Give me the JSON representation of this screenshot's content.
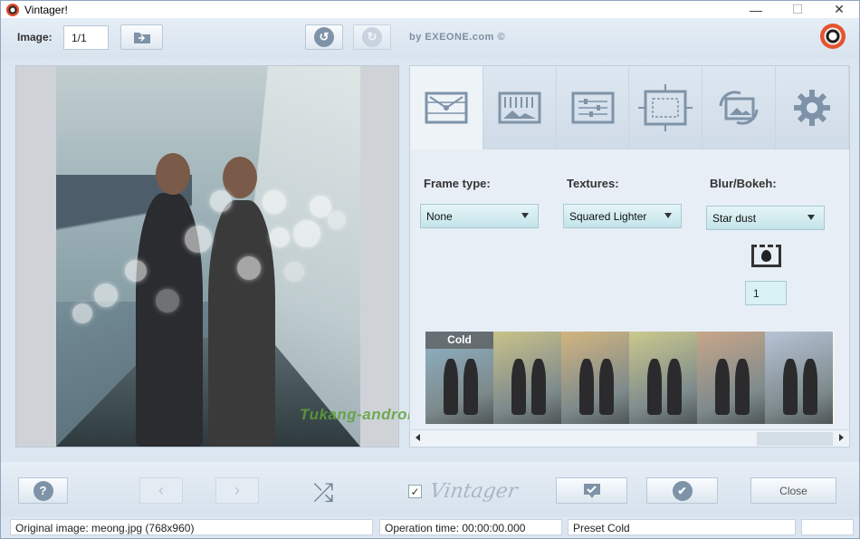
{
  "window": {
    "title": "Vintager!",
    "minimize": "—",
    "maximize": "☐",
    "close": "✕"
  },
  "toolbar": {
    "image_label": "Image:",
    "image_value": "1/1",
    "brand": "by EXEONE.com ©"
  },
  "tabs": [
    {
      "name": "frame",
      "icon": "frame-icon"
    },
    {
      "name": "textures",
      "icon": "texture-icon"
    },
    {
      "name": "adjustments",
      "icon": "sliders-icon"
    },
    {
      "name": "crop",
      "icon": "crop-icon"
    },
    {
      "name": "rotate",
      "icon": "rotate-icon"
    },
    {
      "name": "settings",
      "icon": "gear-icon"
    }
  ],
  "options": {
    "frame_label": "Frame type:",
    "frame_value": "None",
    "textures_label": "Textures:",
    "textures_value": "Squared Lighter",
    "blur_label": "Blur/Bokeh:",
    "blur_value": "Star dust",
    "blur_amount": "1"
  },
  "presets": {
    "active_label": "Cold",
    "tints": [
      "#8fb4c9",
      "#c9c28a",
      "#d3b57f",
      "#cbc98d",
      "#c8a689",
      "#b8c3d6"
    ]
  },
  "watermark": "Tukang-android",
  "bottom": {
    "close_label": "Close",
    "vintager_logo": "Vintager",
    "enabled_checked": "✓"
  },
  "status": {
    "original": "Original image: meong.jpg (768x960)",
    "operation": "Operation time: 00:00:00.000",
    "preset": "Preset Cold",
    "extra": ""
  }
}
